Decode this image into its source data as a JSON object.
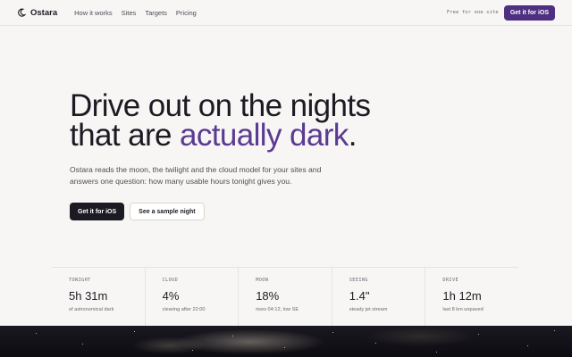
{
  "nav": {
    "brand": "Ostara",
    "links": [
      "How it works",
      "Sites",
      "Targets",
      "Pricing"
    ],
    "free_note": "Free for one site",
    "cta": "Get it for iOS"
  },
  "hero": {
    "headline_line1": "Drive out on the nights",
    "headline_line2_plain": "that are ",
    "headline_line2_accent": "actually dark",
    "headline_line2_end": ".",
    "subtext": "Ostara reads the moon, the twilight and the cloud model for your sites and answers one question: how many usable hours tonight gives you.",
    "primary_cta": "Get it for iOS",
    "secondary_cta": "See a sample night"
  },
  "stats": [
    {
      "label": "TONIGHT",
      "value": "5h 31m",
      "sub": "of astronomical dark"
    },
    {
      "label": "CLOUD",
      "value": "4%",
      "sub": "clearing after 22:00"
    },
    {
      "label": "MOON",
      "value": "18%",
      "sub": "rises 04:12, low SE"
    },
    {
      "label": "SEEING",
      "value": "1.4\"",
      "sub": "steady jet stream"
    },
    {
      "label": "DRIVE",
      "value": "1h 12m",
      "sub": "last 8 km unpaved"
    }
  ],
  "colors": {
    "accent": "#5a3a92",
    "nav_cta": "#4e2f82",
    "primary_cta": "#1c1a22",
    "background": "#f7f6f4"
  },
  "icons": {
    "brand": "crescent-moon-icon"
  }
}
